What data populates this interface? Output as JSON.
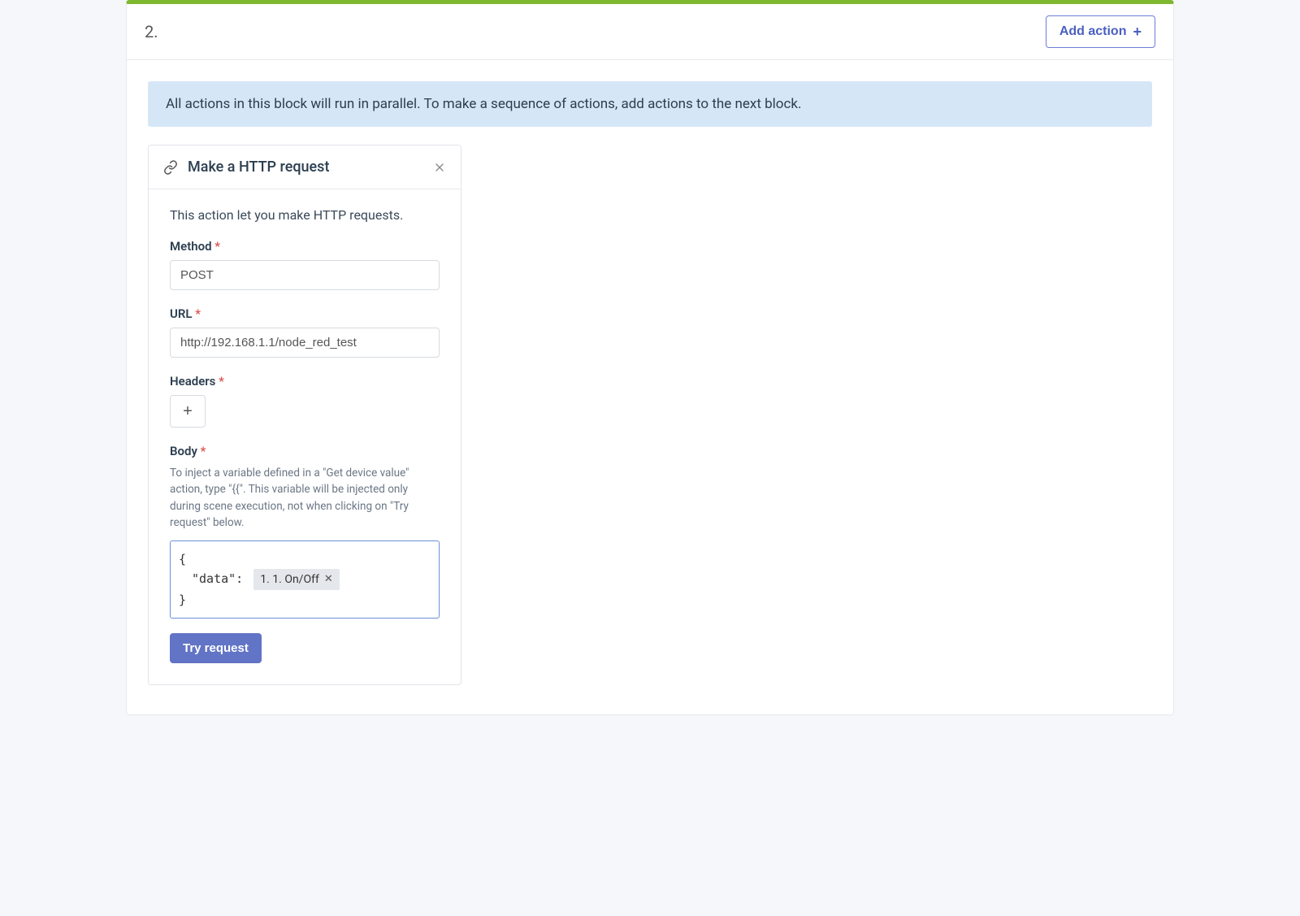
{
  "block": {
    "number": "2.",
    "add_action_label": "Add action"
  },
  "banner": {
    "text": "All actions in this block will run in parallel. To make a sequence of actions, add actions to the next block."
  },
  "action": {
    "title": "Make a HTTP request",
    "description": "This action let you make HTTP requests.",
    "method": {
      "label": "Method",
      "value": "POST"
    },
    "url": {
      "label": "URL",
      "value": "http://192.168.1.1/node_red_test"
    },
    "headers": {
      "label": "Headers"
    },
    "body": {
      "label": "Body",
      "help": "To inject a variable defined in a \"Get device value\" action, type \"{{\". This variable will be injected only during scene execution, not when clicking on \"Try request\" below.",
      "open_brace": "{",
      "data_key": "\"data\":",
      "variable_chip": "1. 1. On/Off",
      "close_brace": "}"
    },
    "try_label": "Try request"
  }
}
